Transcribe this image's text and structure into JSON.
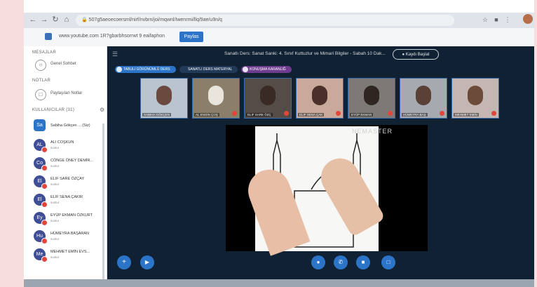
{
  "browser": {
    "url": "507g5aeoecoersml/nirf/nvbrn/joi/mqwnl/Iwenrmi/llq/9ae/u9n/q",
    "info_text": "www.youtube.com 1R?gbarbhsorrwt 9 eaifaphon",
    "info_button": "Paylas",
    "icons": [
      "back-icon",
      "forward-icon",
      "reload-icon",
      "lock-icon",
      "star-icon",
      "extension-icon",
      "menu-icon"
    ]
  },
  "sidebar": {
    "section_messages": "MESAJLAR",
    "public_chat": "Genel Sohbet",
    "section_notes": "NOTLAR",
    "shared_notes": "Paylaşılan Notlar",
    "section_users": "KULLANICILAR (31)",
    "users": [
      {
        "initials": "Sa",
        "name": "Sabiha Gökçen ... (Siz)",
        "status": ""
      },
      {
        "initials": "AL",
        "name": "ALI COŞKUN",
        "status": "sustur"
      },
      {
        "initials": "Co",
        "name": "CÖNGE ÖNEY DEMİR...",
        "status": "sustur"
      },
      {
        "initials": "El",
        "name": "ELIF SARE ÖZÇAY",
        "status": "sustur"
      },
      {
        "initials": "El",
        "name": "ELIF SENA ÇAKIR",
        "status": "sustur"
      },
      {
        "initials": "Ey",
        "name": "EYÜP EKMAN ÖZKURT",
        "status": "sustur"
      },
      {
        "initials": "Hu",
        "name": "HÜMEYRA BAŞARAN",
        "status": "sustur"
      },
      {
        "initials": "Me",
        "name": "MEHMET EMİN EVS...",
        "status": "sustur"
      }
    ]
  },
  "main": {
    "title": "Sanatlı Ders: Sanat Sanki: 4. Sınıf Kuttuzlur ve Mimari Bilgiler - Sabah 10 Dak...",
    "record_button": "Kaydı Başlat",
    "chips": [
      {
        "label": "TABULI GÖRÜNÜMLÜ DERS",
        "color": "#2c74c7"
      },
      {
        "label": "SANATLI DERS MATERYAL",
        "color": "#213a57"
      },
      {
        "label": "KONUŞMA KARANLIĞ",
        "color": "#6f3c8f"
      }
    ],
    "tiles": [
      {
        "label": "SABIHA GÖKÇEN",
        "bg": "#b9c4cf",
        "head": "#6a4a3e"
      },
      {
        "label": "AL ENGİN ÇOŞ",
        "bg": "#8b7f6a",
        "head": "#e9e4dc"
      },
      {
        "label": "ELIF SARE ÖZÇ",
        "bg": "#554c47",
        "head": "#3a2a25"
      },
      {
        "label": "ELIF SENA ÇAK",
        "bg": "#c8a99a",
        "head": "#4a3028"
      },
      {
        "label": "EYÜP EKMAN",
        "bg": "#7d7a76",
        "head": "#2f2622"
      },
      {
        "label": "HÜMEYRA BAŞ",
        "bg": "#a6a9b0",
        "head": "#5a4036"
      },
      {
        "label": "MEHMET EMİN",
        "bg": "#c4b6b2",
        "head": "#6d4b3b"
      }
    ],
    "watermark": "NEMASTER",
    "controls": [
      "add-icon",
      "share-icon",
      "mic-icon",
      "phone-icon",
      "camera-icon",
      "screen-share-icon"
    ]
  },
  "colors": {
    "accent": "#2c74c7",
    "app_bg": "#0f2132",
    "page_bg": "#f6dede"
  }
}
